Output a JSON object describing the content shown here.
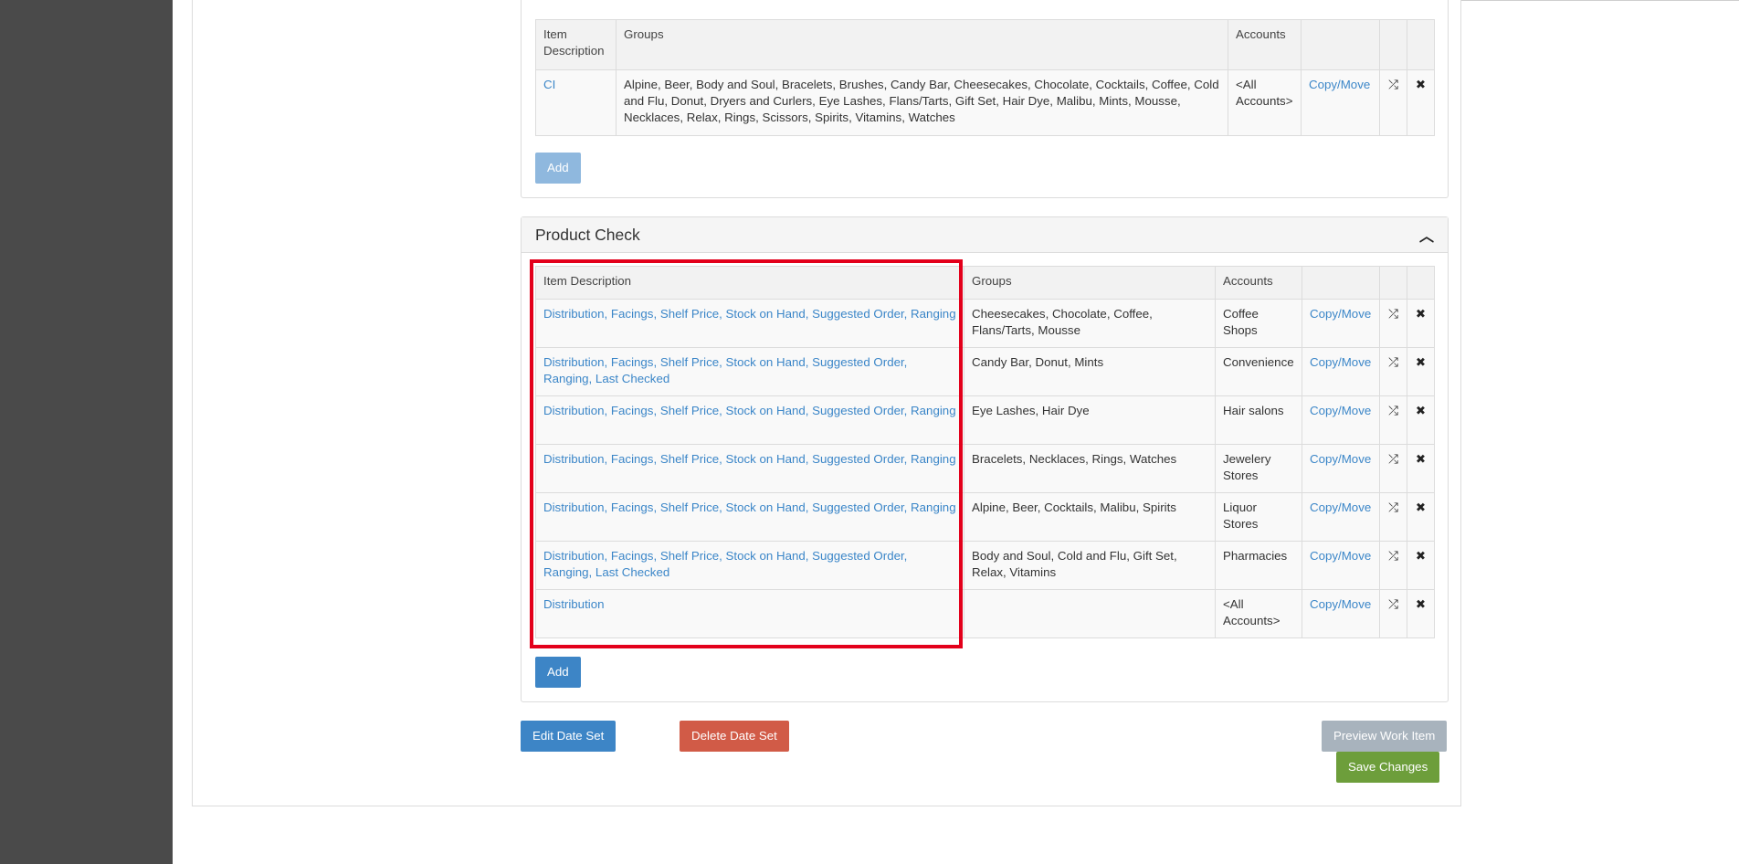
{
  "top_table": {
    "headers": [
      "Item Description",
      "Groups",
      "Accounts",
      "",
      "",
      ""
    ],
    "rows": [
      {
        "item": "CI",
        "groups": "Alpine, Beer, Body and Soul, Bracelets, Brushes, Candy Bar, Cheesecakes, Chocolate, Cocktails, Coffee, Cold and Flu, Donut, Dryers and Curlers, Eye Lashes, Flans/Tarts, Gift Set, Hair Dye, Malibu, Mints, Mousse, Necklaces, Relax, Rings, Scissors, Spirits, Vitamins, Watches",
        "accounts": "<All Accounts>",
        "action": "Copy/Move"
      }
    ],
    "add_label": "Add"
  },
  "product_check": {
    "title": "Product Check",
    "headers": [
      "Item Description",
      "Groups",
      "Accounts",
      "",
      "",
      ""
    ],
    "rows": [
      {
        "item": "Distribution, Facings, Shelf Price, Stock on Hand, Suggested Order, Ranging",
        "groups": "Cheesecakes, Chocolate, Coffee, Flans/Tarts, Mousse",
        "accounts": "Coffee Shops",
        "action": "Copy/Move"
      },
      {
        "item": "Distribution, Facings, Shelf Price, Stock on Hand, Suggested Order, Ranging, Last Checked",
        "groups": "Candy Bar, Donut, Mints",
        "accounts": "Convenience",
        "action": "Copy/Move"
      },
      {
        "item": "Distribution, Facings, Shelf Price, Stock on Hand, Suggested Order, Ranging",
        "groups": "Eye Lashes, Hair Dye",
        "accounts": "Hair salons",
        "action": "Copy/Move"
      },
      {
        "item": "Distribution, Facings, Shelf Price, Stock on Hand, Suggested Order, Ranging",
        "groups": "Bracelets, Necklaces, Rings, Watches",
        "accounts": "Jewelery Stores",
        "action": "Copy/Move"
      },
      {
        "item": "Distribution, Facings, Shelf Price, Stock on Hand, Suggested Order, Ranging",
        "groups": "Alpine, Beer, Cocktails, Malibu, Spirits",
        "accounts": "Liquor Stores",
        "action": "Copy/Move"
      },
      {
        "item": "Distribution, Facings, Shelf Price, Stock on Hand, Suggested Order, Ranging, Last Checked",
        "groups": "Body and Soul, Cold and Flu, Gift Set, Relax, Vitamins",
        "accounts": "Pharmacies",
        "action": "Copy/Move"
      },
      {
        "item": "Distribution",
        "groups": "",
        "accounts": "<All Accounts>",
        "action": "Copy/Move"
      }
    ],
    "add_label": "Add"
  },
  "footer": {
    "edit_date_set": "Edit Date Set",
    "delete_date_set": "Delete Date Set",
    "preview_work_item": "Preview Work Item",
    "save_changes": "Save Changes"
  },
  "icons": {
    "shuffle": "shuffle-icon",
    "close": "close-icon",
    "collapse": "chevron-up-icon"
  },
  "colors": {
    "link": "#3b86c8",
    "primary": "#3d85c6",
    "danger": "#d15b47",
    "success": "#6d9e3b",
    "disabled": "#a8b3bd",
    "highlight": "#e3001b"
  }
}
